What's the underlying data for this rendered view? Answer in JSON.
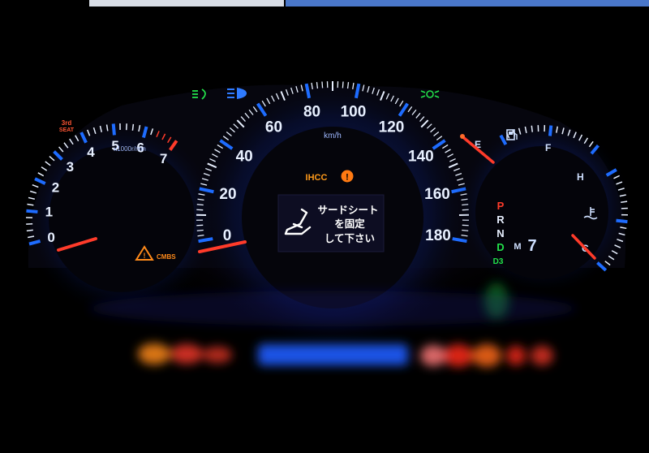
{
  "top_strip": {
    "left_color": "#d8dde6",
    "right_color": "#4a77c9"
  },
  "tachometer": {
    "labels": [
      "0",
      "1",
      "2",
      "3",
      "4",
      "5",
      "6",
      "7"
    ],
    "unit": "x1000r/min",
    "seat_label_line1": "3rd",
    "seat_label_line2": "SEAT",
    "cmbs_label": "CMBS"
  },
  "speedometer": {
    "labels": [
      "0",
      "20",
      "40",
      "60",
      "80",
      "100",
      "120",
      "140",
      "160",
      "180"
    ],
    "unit": "km/h"
  },
  "center_display": {
    "ihcc_label": "IHCC",
    "message_line1": "サードシート",
    "message_line2": "を固定",
    "message_line3": "して下さい"
  },
  "fuel_temp": {
    "fuel_empty": "E",
    "fuel_full": "F",
    "temp_hot": "H",
    "temp_cold": "C"
  },
  "gear_indicator": {
    "gears": [
      "P",
      "R",
      "N",
      "D",
      "D3"
    ],
    "mode_label": "M",
    "mode_value": "7"
  },
  "colors": {
    "gauge_blue": "#1e6cff",
    "needle_red": "#ff3b2a",
    "tick_white": "#e8f0ff",
    "warning_orange": "#ff8a1a",
    "indicator_green": "#22e04a",
    "beam_blue": "#2f7bff"
  },
  "icons": [
    "fog-light-icon",
    "headlight-icon",
    "sidelight-icon",
    "fuel-pump-icon",
    "coolant-temp-icon",
    "seat-warning-icon",
    "master-warning-icon",
    "cmbs-warning-icon"
  ]
}
